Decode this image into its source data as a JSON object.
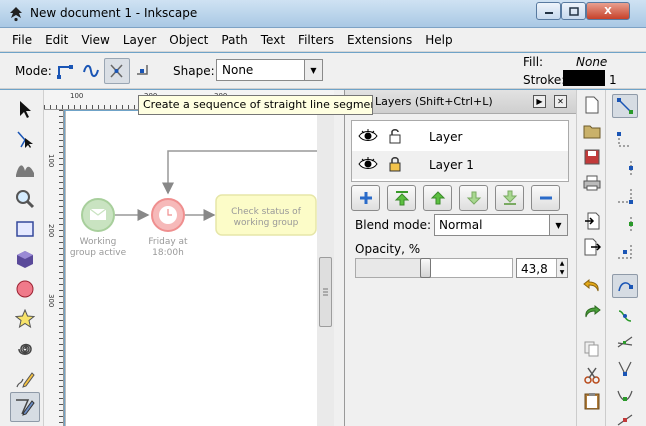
{
  "window": {
    "title": "New document 1 - Inkscape",
    "close_label": "X"
  },
  "menu": [
    {
      "label": "File"
    },
    {
      "label": "Edit"
    },
    {
      "label": "View"
    },
    {
      "label": "Layer"
    },
    {
      "label": "Object"
    },
    {
      "label": "Path"
    },
    {
      "label": "Text"
    },
    {
      "label": "Filters"
    },
    {
      "label": "Extensions"
    },
    {
      "label": "Help"
    }
  ],
  "controls": {
    "mode_label": "Mode:",
    "shape_label": "Shape:",
    "shape_value": "None",
    "fill_label": "Fill:",
    "fill_value": "None",
    "stroke_label": "Stroke:",
    "stroke_width": "1",
    "stroke_color": "#000000"
  },
  "tooltip": "Create a sequence of straight line segments",
  "ruler": {
    "marks": [
      "100",
      "200",
      "300"
    ]
  },
  "canvas": {
    "nodes": [
      {
        "id": "start",
        "label_line1": "Working",
        "label_line2": "group active",
        "color": "#c9e3c1"
      },
      {
        "id": "timer",
        "label_line1": "Friday at",
        "label_line2": "18:00h",
        "color": "#f6b9b9"
      },
      {
        "id": "task",
        "label_line1": "Check status of",
        "label_line2": "working group",
        "color": "#fcfcc8"
      }
    ]
  },
  "layers_panel": {
    "title": "Layers (Shift+Ctrl+L)",
    "layers": [
      {
        "name": "Layer",
        "locked": false
      },
      {
        "name": "Layer 1",
        "locked": true
      }
    ],
    "blend_label": "Blend mode:",
    "blend_value": "Normal",
    "opacity_label": "Opacity, %",
    "opacity_value": "43,8",
    "opacity_fraction": 0.438
  }
}
